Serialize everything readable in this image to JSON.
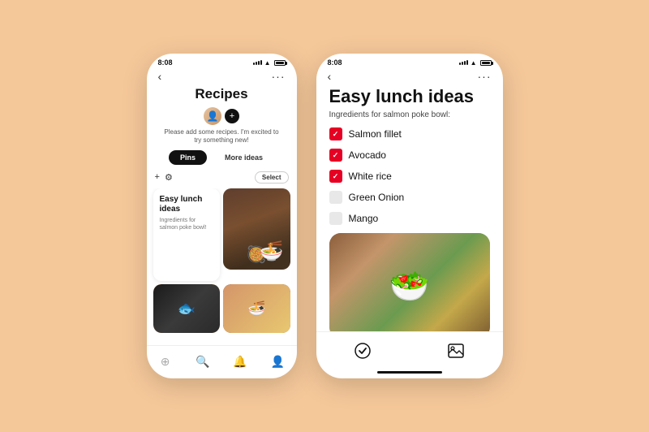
{
  "colors": {
    "background": "#f5c89a",
    "phone_bg": "#ffffff",
    "accent_red": "#e60023",
    "text_dark": "#111111",
    "text_gray": "#777777"
  },
  "left_phone": {
    "status_time": "8:08",
    "back_label": "‹",
    "more_label": "···",
    "page_title": "Recipes",
    "add_text": "Please add some recipes. I'm excited to try something new!",
    "tabs": [
      {
        "label": "Pins",
        "active": true
      },
      {
        "label": "More ideas",
        "active": false
      }
    ],
    "toolbar": {
      "add_icon": "+",
      "filter_icon": "⚙",
      "select_label": "Select"
    },
    "pin_card": {
      "title": "Easy lunch ideas",
      "description": "Ingredients for salmon poke bowl!"
    },
    "bottom_nav_items": [
      "●",
      "🔍",
      "🔔",
      "👤"
    ]
  },
  "right_phone": {
    "status_time": "8:08",
    "back_label": "‹",
    "more_label": "···",
    "board_title": "Easy lunch ideas",
    "ingredients_label": "Ingredients for salmon poke bowl:",
    "ingredients": [
      {
        "name": "Salmon fillet",
        "checked": true
      },
      {
        "name": "Avocado",
        "checked": true
      },
      {
        "name": "White rice",
        "checked": true
      },
      {
        "name": "Green Onion",
        "checked": false
      },
      {
        "name": "Mango",
        "checked": false
      }
    ],
    "bottom_toolbar": {
      "check_icon": "✓",
      "image_icon": "🖼"
    }
  }
}
